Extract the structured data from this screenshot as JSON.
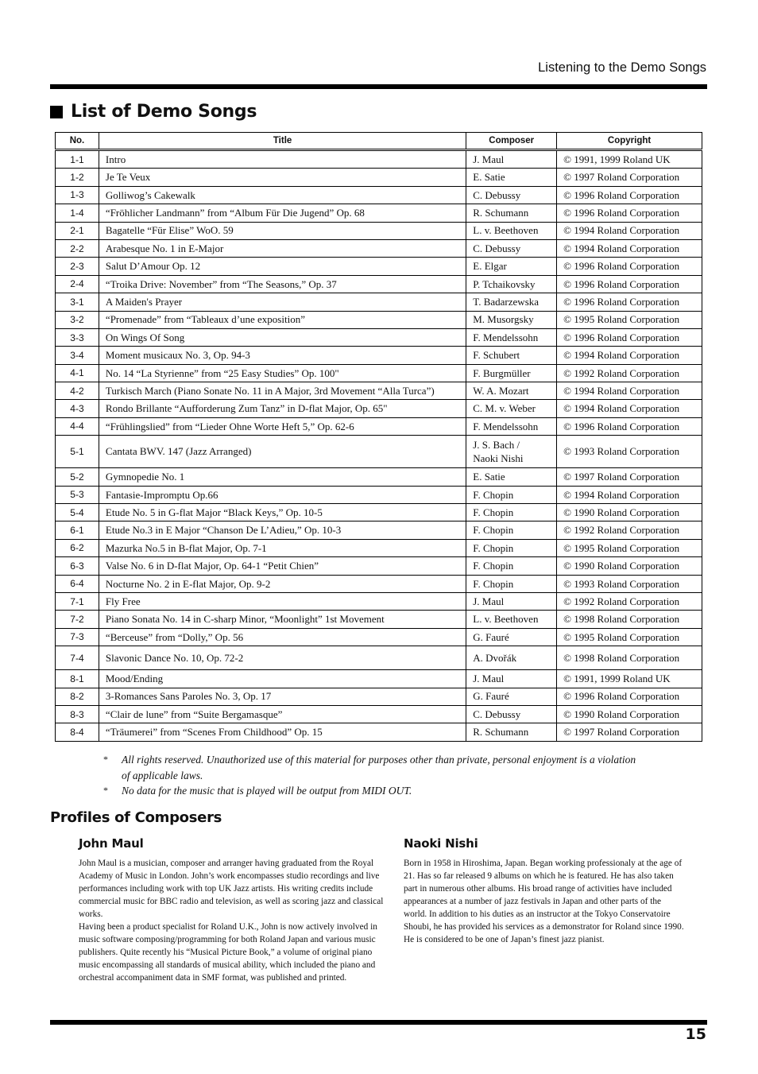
{
  "header": {
    "running_title": "Listening to the Demo Songs"
  },
  "section": {
    "title": "List of Demo Songs"
  },
  "table": {
    "columns": [
      "No.",
      "Title",
      "Composer",
      "Copyright"
    ],
    "rows": [
      {
        "no": "1-1",
        "title": "Intro",
        "composer": "J. Maul",
        "copyright": "© 1991, 1999 Roland UK"
      },
      {
        "no": "1-2",
        "title": "Je Te Veux",
        "composer": "E. Satie",
        "copyright": "© 1997 Roland Corporation"
      },
      {
        "no": "1-3",
        "title": "Golliwog’s Cakewalk",
        "composer": "C. Debussy",
        "copyright": "© 1996 Roland Corporation"
      },
      {
        "no": "1-4",
        "title": "“Fröhlicher Landmann” from “Album Für Die Jugend” Op. 68",
        "composer": "R. Schumann",
        "copyright": "© 1996 Roland Corporation"
      },
      {
        "no": "2-1",
        "title": "Bagatelle “Für Elise” WoO. 59",
        "composer": "L. v. Beethoven",
        "copyright": "© 1994 Roland Corporation"
      },
      {
        "no": "2-2",
        "title": "Arabesque No. 1 in E-Major",
        "composer": "C. Debussy",
        "copyright": "© 1994 Roland Corporation"
      },
      {
        "no": "2-3",
        "title": "Salut D’Amour Op. 12",
        "composer": "E. Elgar",
        "copyright": "© 1996 Roland Corporation"
      },
      {
        "no": "2-4",
        "title": "“Troika Drive: November” from “The Seasons,” Op. 37",
        "composer": "P. Tchaikovsky",
        "copyright": "© 1996 Roland Corporation"
      },
      {
        "no": "3-1",
        "title": "A Maiden's Prayer",
        "composer": "T. Badarzewska",
        "copyright": "© 1996 Roland Corporation"
      },
      {
        "no": "3-2",
        "title": "“Promenade” from “Tableaux d’une exposition”",
        "composer": "M. Musorgsky",
        "copyright": "© 1995 Roland Corporation"
      },
      {
        "no": "3-3",
        "title": "On Wings Of Song",
        "composer": "F. Mendelssohn",
        "copyright": "© 1996 Roland Corporation"
      },
      {
        "no": "3-4",
        "title": "Moment musicaux No. 3, Op. 94-3",
        "composer": "F. Schubert",
        "copyright": "© 1994 Roland Corporation"
      },
      {
        "no": "4-1",
        "title": "No. 14 “La Styrienne” from “25 Easy Studies” Op. 100\"",
        "composer": "F. Burgmüller",
        "copyright": "© 1992 Roland Corporation"
      },
      {
        "no": "4-2",
        "title": "Turkisch March (Piano Sonate No. 11 in A Major, 3rd Movement “Alla Turca”)",
        "composer": "W. A. Mozart",
        "copyright": "© 1994 Roland Corporation"
      },
      {
        "no": "4-3",
        "title": "Rondo Brillante “Aufforderung Zum Tanz” in D-flat Major, Op. 65\"",
        "composer": "C. M. v. Weber",
        "copyright": "© 1994 Roland Corporation"
      },
      {
        "no": "4-4",
        "title": "“Frühlingslied” from “Lieder Ohne Worte Heft 5,” Op. 62-6",
        "composer": "F. Mendelssohn",
        "copyright": "© 1996 Roland Corporation"
      },
      {
        "no": "5-1",
        "title": "Cantata BWV. 147 (Jazz Arranged)",
        "composer": "J. S. Bach /\nNaoki Nishi",
        "copyright": "© 1993 Roland Corporation"
      },
      {
        "no": "5-2",
        "title": "Gymnopedie No. 1",
        "composer": "E. Satie",
        "copyright": "© 1997 Roland Corporation"
      },
      {
        "no": "5-3",
        "title": "Fantasie-Impromptu Op.66",
        "composer": "F. Chopin",
        "copyright": "© 1994 Roland Corporation"
      },
      {
        "no": "5-4",
        "title": "Etude No. 5 in G-flat Major “Black Keys,” Op. 10-5",
        "composer": "F. Chopin",
        "copyright": "© 1990 Roland Corporation"
      },
      {
        "no": "6-1",
        "title": "Etude No.3 in E Major “Chanson De L’Adieu,” Op. 10-3",
        "composer": "F. Chopin",
        "copyright": "© 1992 Roland Corporation"
      },
      {
        "no": "6-2",
        "title": "Mazurka No.5 in B-flat Major, Op. 7-1",
        "composer": "F. Chopin",
        "copyright": "© 1995 Roland Corporation"
      },
      {
        "no": "6-3",
        "title": "Valse No. 6 in D-flat Major, Op. 64-1 “Petit Chien”",
        "composer": "F. Chopin",
        "copyright": "© 1990 Roland Corporation"
      },
      {
        "no": "6-4",
        "title": "Nocturne No. 2 in E-flat Major, Op. 9-2",
        "composer": "F. Chopin",
        "copyright": "© 1993 Roland Corporation"
      },
      {
        "no": "7-1",
        "title": "Fly Free",
        "composer": "J. Maul",
        "copyright": "© 1992 Roland Corporation"
      },
      {
        "no": "7-2",
        "title": "Piano Sonata No. 14 in C-sharp Minor, “Moonlight” 1st Movement",
        "composer": "L. v. Beethoven",
        "copyright": "© 1998 Roland Corporation"
      },
      {
        "no": "7-3",
        "title": "“Berceuse” from “Dolly,” Op. 56",
        "composer": "G. Fauré",
        "copyright": "© 1995 Roland Corporation"
      },
      {
        "no": "7-4",
        "title": "Slavonic Dance No. 10, Op. 72-2",
        "composer": "A. Dvořák",
        "copyright": "© 1998 Roland Corporation"
      },
      {
        "no": "8-1",
        "title": "Mood/Ending",
        "composer": "J. Maul",
        "copyright": "© 1991, 1999 Roland UK"
      },
      {
        "no": "8-2",
        "title": "3-Romances Sans Paroles No. 3, Op. 17",
        "composer": "G. Fauré",
        "copyright": "© 1996 Roland Corporation"
      },
      {
        "no": "8-3",
        "title": "“Clair de lune” from “Suite Bergamasque”",
        "composer": "C. Debussy",
        "copyright": "© 1990 Roland Corporation"
      },
      {
        "no": "8-4",
        "title": "“Träumerei” from “Scenes From Childhood” Op. 15",
        "composer": "R. Schumann",
        "copyright": "© 1997 Roland Corporation"
      }
    ]
  },
  "notes": [
    {
      "marker": "*",
      "text": "All rights reserved. Unauthorized use of this material for purposes other than private, personal enjoyment is a violation of applicable laws."
    },
    {
      "marker": "*",
      "text": "No data for the music that is played will be output from MIDI OUT."
    }
  ],
  "profiles": {
    "title": "Profiles of Composers",
    "items": [
      {
        "name": "John Maul",
        "bio": "John Maul is a musician, composer and arranger having graduated from the Royal Academy of Music in London. John’s work encompasses studio recordings and live performances including work with top UK Jazz artists. His writing credits include commercial music for BBC radio and television, as well as scoring jazz and classical works.\nHaving been a product specialist for Roland U.K., John is now actively involved in music software composing/programming for both Roland Japan and various music publishers. Quite recently his “Musical Picture Book,” a volume of original piano music encompassing all standards of musical ability, which included the piano and orchestral accompaniment data in SMF format, was published and printed."
      },
      {
        "name": "Naoki Nishi",
        "bio": "Born in 1958 in Hiroshima, Japan. Began working professionaly at the age of 21. Has so far released 9 albums on which he is featured. He has also taken part in numerous other albums. His broad range of activities have included appearances at a number of jazz festivals in Japan and other parts of the world. In addition to his duties as an instructor at the Tokyo Conservatoire Shoubi, he has provided his services as a demonstrator for Roland since 1990. He is considered to be one of Japan’s finest jazz pianist."
      }
    ]
  },
  "footer": {
    "page_number": "15"
  }
}
